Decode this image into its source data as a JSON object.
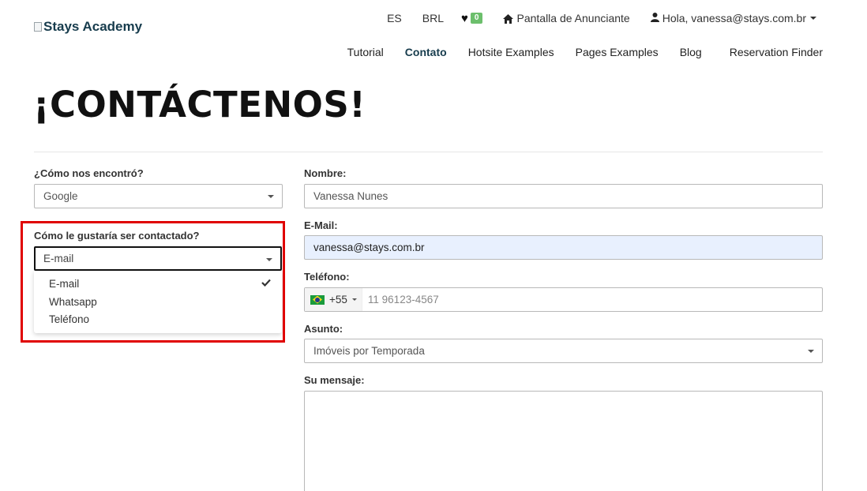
{
  "header": {
    "logo_text": "Stays Academy",
    "language": "ES",
    "currency": "BRL",
    "favorites_count": "0",
    "advertiser_link": "Pantalla de Anunciante",
    "user_greeting": "Hola, vanessa@stays.com.br"
  },
  "nav": {
    "items": [
      {
        "label": "Tutorial"
      },
      {
        "label": "Contato"
      },
      {
        "label": "Hotsite Examples"
      },
      {
        "label": "Pages Examples"
      },
      {
        "label": "Blog"
      },
      {
        "label": "Reservation Finder"
      }
    ]
  },
  "page": {
    "title": "¡CONTÁCTENOS!"
  },
  "form": {
    "found_label": "¿Cómo nos encontró?",
    "found_value": "Google",
    "contact_label": "Cómo le gustaría ser contactado?",
    "contact_value": "E-mail",
    "contact_options": [
      "E-mail",
      "Whatsapp",
      "Teléfono"
    ],
    "name_label": "Nombre:",
    "name_value": "Vanessa Nunes",
    "email_label": "E-Mail:",
    "email_value": "vanessa@stays.com.br",
    "phone_label": "Teléfono:",
    "phone_code": "+55",
    "phone_placeholder": "11 96123-4567",
    "subject_label": "Asunto:",
    "subject_value": "Imóveis por Temporada",
    "message_label": "Su mensaje:"
  },
  "colors": {
    "brand": "#173c4d",
    "highlight": "#e00000",
    "badge": "#6cbf6c",
    "autofill": "#e8f0fe"
  }
}
